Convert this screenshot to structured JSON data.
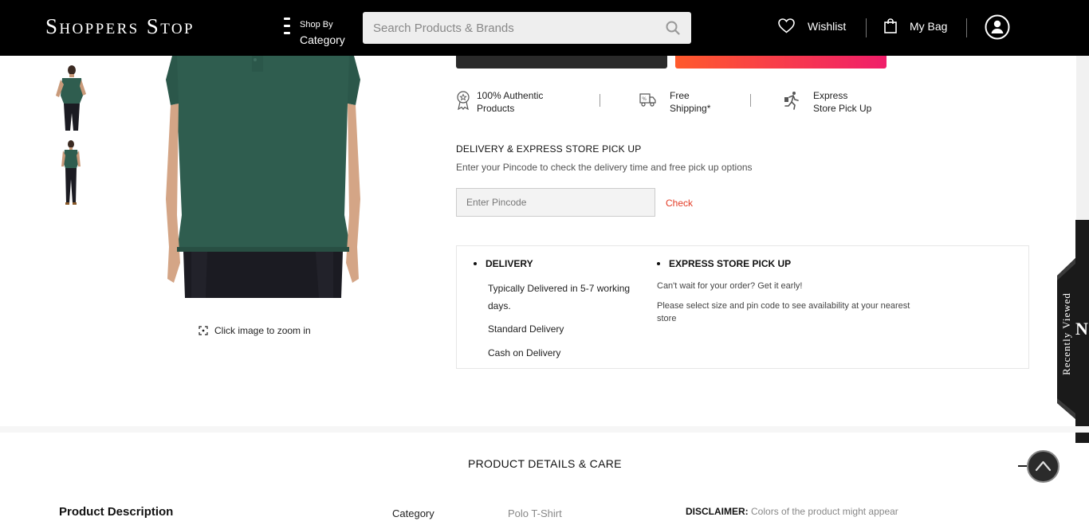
{
  "header": {
    "logo": "Shoppers Stop",
    "shop_by_top": "Shop By",
    "shop_by_bottom": "Category",
    "search_placeholder": "Search Products & Brands",
    "wishlist_label": "Wishlist",
    "bag_label": "My Bag"
  },
  "gallery": {
    "zoom_hint": "Click image to zoom in",
    "product_color": "#2f5d4f"
  },
  "usps": [
    {
      "icon": "badge-icon",
      "line1": "100% Authentic",
      "line2": "Products"
    },
    {
      "icon": "truck-icon",
      "line1": "Free",
      "line2": "Shipping*"
    },
    {
      "icon": "runner-icon",
      "line1": "Express",
      "line2": "Store Pick Up"
    }
  ],
  "delivery": {
    "title": "DELIVERY & EXPRESS STORE PICK UP",
    "subtitle": "Enter your Pincode to check the delivery time and free pick up options",
    "pincode_placeholder": "Enter Pincode",
    "check_label": "Check",
    "delivery_heading": "DELIVERY",
    "delivery_line1": "Typically Delivered in 5-7 working",
    "delivery_line2": "days.",
    "standard": "Standard Delivery",
    "cod": "Cash on Delivery",
    "express_heading": "EXPRESS STORE PICK UP",
    "express_line1": "Can't wait for your order? Get it early!",
    "express_line2": "Please select size and pin code to see availability at your nearest",
    "express_line3": "store"
  },
  "recently_viewed": {
    "label": "Recently Viewed",
    "initial": "N"
  },
  "details": {
    "title": "PRODUCT DETAILS & CARE",
    "description_heading": "Product Description",
    "category_label": "Category",
    "category_value": "Polo T-Shirt",
    "disclaimer_label": "DISCLAIMER:",
    "disclaimer_text": "Colors of the product might appear"
  }
}
